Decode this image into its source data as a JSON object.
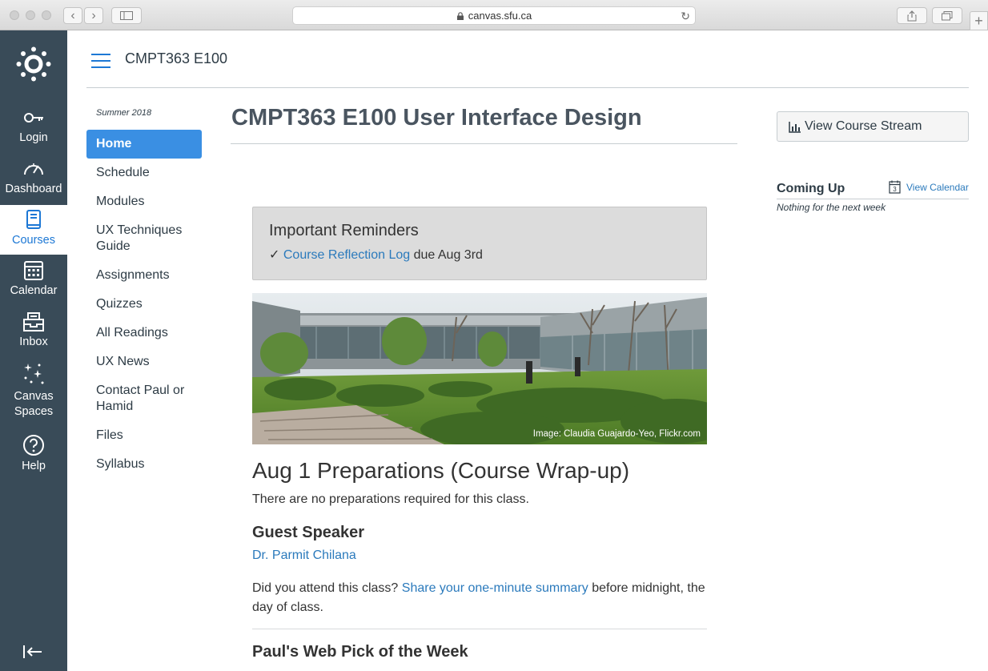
{
  "browser": {
    "url": "canvas.sfu.ca"
  },
  "global_nav": {
    "items": [
      {
        "label": "Login",
        "icon": "key-icon"
      },
      {
        "label": "Dashboard",
        "icon": "speedometer-icon"
      },
      {
        "label": "Courses",
        "icon": "book-icon",
        "active": true
      },
      {
        "label": "Calendar",
        "icon": "calendar-icon"
      },
      {
        "label": "Inbox",
        "icon": "inbox-icon"
      },
      {
        "label": "Canvas Spaces",
        "icon": "sparkle-icon"
      },
      {
        "label": "Help",
        "icon": "help-icon"
      }
    ],
    "accent": "#1d78d5",
    "background": "#394b58"
  },
  "header": {
    "breadcrumb": "CMPT363 E100"
  },
  "course_nav": {
    "term": "Summer 2018",
    "items": [
      "Home",
      "Schedule",
      "Modules",
      "UX Techniques Guide",
      "Assignments",
      "Quizzes",
      "All Readings",
      "UX News",
      "Contact Paul or Hamid",
      "Files",
      "Syllabus"
    ],
    "active": "Home"
  },
  "main": {
    "title": "CMPT363 E100 User Interface Design",
    "reminders": {
      "heading": "Important Reminders",
      "check": "✓",
      "link": "Course Reflection Log",
      "suffix": " due Aug 3rd"
    },
    "hero_caption": "Image: Claudia Guajardo-Yeo, Flickr.com",
    "section_heading": "Aug 1 Preparations (Course Wrap-up)",
    "prep_text": "There are no preparations required for this class.",
    "guest_heading": "Guest Speaker",
    "guest_link": "Dr. Parmit Chilana",
    "attend_prefix": "Did you attend this class? ",
    "attend_link": "Share your one-minute summary",
    "attend_suffix": " before midnight, the day of class.",
    "web_pick_heading": "Paul's Web Pick of the Week"
  },
  "sidebar_right": {
    "stream_button": "View Course Stream",
    "coming_up": "Coming Up",
    "view_calendar": "View Calendar",
    "calendar_day": "3",
    "nothing": "Nothing for the next week"
  }
}
